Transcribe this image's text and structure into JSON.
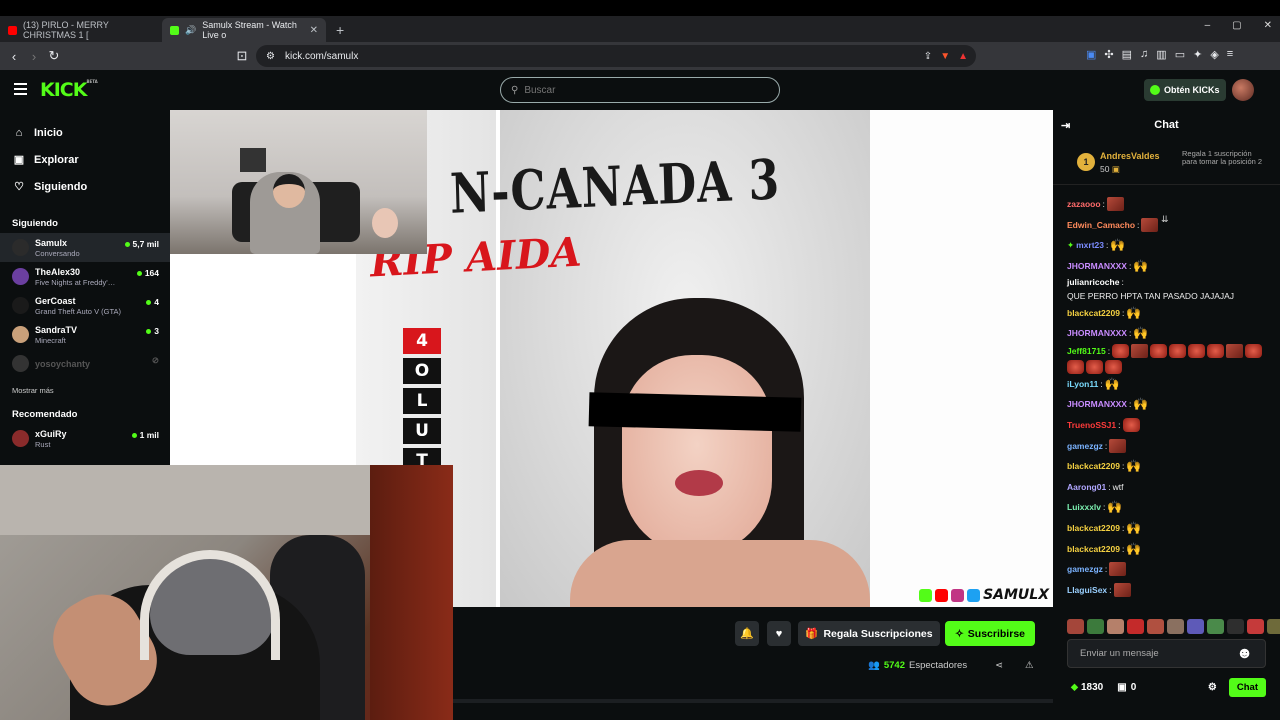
{
  "browser": {
    "tabs": [
      {
        "title": "(13) PIRLO - MERRY CHRISTMAS 1 [",
        "favicon_color": "#ff0000"
      },
      {
        "title": "Samulx Stream - Watch Live o",
        "favicon_color": "#53fc18"
      }
    ],
    "new_tab": "+",
    "url": "kick.com/samulx",
    "window_controls": [
      "–",
      "▢",
      "✕"
    ]
  },
  "header": {
    "logo": "KICK",
    "logo_tag": "BETA",
    "search_placeholder": "Buscar",
    "get_kicks": "Obtén KICKs"
  },
  "sidebar": {
    "nav": [
      {
        "label": "Inicio",
        "icon": "home-icon"
      },
      {
        "label": "Explorar",
        "icon": "compass-icon"
      },
      {
        "label": "Siguiendo",
        "icon": "heart-icon"
      }
    ],
    "following_title": "Siguiendo",
    "following": [
      {
        "name": "Samulx",
        "sub": "Conversando",
        "viewers": "5,7 mil",
        "avatar_color": "#2b2b2b"
      },
      {
        "name": "TheAlex30",
        "sub": "Five Nights at Freddy'…",
        "viewers": "164",
        "avatar_color": "#6b3fa0"
      },
      {
        "name": "GerCoast",
        "sub": "Grand Theft Auto V (GTA)",
        "viewers": "4",
        "avatar_color": "#1a1a1a"
      },
      {
        "name": "SandraTV",
        "sub": "Minecraft",
        "viewers": "3",
        "avatar_color": "#c9a07a"
      },
      {
        "name": "yosoychanty",
        "sub": "",
        "viewers": "",
        "avatar_color": "#333333"
      }
    ],
    "show_more": "Mostrar más",
    "recommended_title": "Recomendado",
    "recommended": [
      {
        "name": "xGuiRy",
        "sub": "Rust",
        "viewers": "1 mil",
        "avatar_color": "#8a2b2b"
      }
    ]
  },
  "video": {
    "title_top": "N-CANADA 3",
    "title_red": "RIP AIDA",
    "vertical_letters": [
      "4",
      "O",
      "L",
      "U",
      "T"
    ],
    "watermark": "SAMULX"
  },
  "below_video": {
    "gift_label": "Regala Suscripciones",
    "subscribe_label": "Suscribirse",
    "viewer_count": "5742",
    "viewer_label": "Espectadores"
  },
  "chat": {
    "title": "Chat",
    "pinned": {
      "rank": "1",
      "name": "AndresValdes",
      "count": "50",
      "note": "Regala 1 suscripción para tomar la posición 2"
    },
    "messages": [
      {
        "user": "zazaooo",
        "color": "#ff6b6b",
        "text": "",
        "emotes": [
          "img"
        ]
      },
      {
        "user": "Edwin_Camacho",
        "color": "#ff8a5c",
        "text": "",
        "emotes": [
          "img"
        ]
      },
      {
        "user": "mxrt23",
        "color": "#7b8cff",
        "text": "",
        "emotes": [
          "hands"
        ],
        "badge": true
      },
      {
        "user": "JHORMANXXX",
        "color": "#c98cff",
        "text": "",
        "emotes": [
          "hands"
        ]
      },
      {
        "user": "julianricoche",
        "color": "#ffffff",
        "text": "QUE PERRO HPTA TAN PASADO JAJAJAJ",
        "emotes": []
      },
      {
        "user": "blackcat2209",
        "color": "#f5d142",
        "text": "",
        "emotes": [
          "hands"
        ]
      },
      {
        "user": "JHORMANXXX",
        "color": "#c98cff",
        "text": "",
        "emotes": [
          "hands"
        ]
      },
      {
        "user": "Jeff81715",
        "color": "#53fc18",
        "text": "",
        "emotes": [
          "devil",
          "img",
          "devil",
          "devil",
          "devil",
          "devil",
          "img",
          "devil",
          "devil",
          "devil",
          "devil"
        ]
      },
      {
        "user": "iLyon11",
        "color": "#7bdcff",
        "text": "",
        "emotes": [
          "hands"
        ]
      },
      {
        "user": "JHORMANXXX",
        "color": "#c98cff",
        "text": "",
        "emotes": [
          "hands"
        ]
      },
      {
        "user": "TruenoSSJ1",
        "color": "#ff3b3b",
        "text": "",
        "emotes": [
          "devil"
        ]
      },
      {
        "user": "gamezgz",
        "color": "#7bb3ff",
        "text": "",
        "emotes": [
          "img"
        ]
      },
      {
        "user": "blackcat2209",
        "color": "#f5d142",
        "text": "",
        "emotes": [
          "hands"
        ]
      },
      {
        "user": "Aarong01",
        "color": "#b1a7ff",
        "text": "wtf",
        "emotes": []
      },
      {
        "user": "Luixxxlv",
        "color": "#7cf0b0",
        "text": "",
        "emotes": [
          "hands"
        ]
      },
      {
        "user": "blackcat2209",
        "color": "#f5d142",
        "text": "",
        "emotes": [
          "hands"
        ]
      },
      {
        "user": "blackcat2209",
        "color": "#f5d142",
        "text": "",
        "emotes": [
          "hands"
        ]
      },
      {
        "user": "gamezgz",
        "color": "#7bb3ff",
        "text": "",
        "emotes": [
          "img"
        ]
      },
      {
        "user": "LlaguiSex",
        "color": "#9ad0ff",
        "text": "",
        "emotes": [
          "img"
        ]
      }
    ],
    "emote_bar_colors": [
      "#a4463a",
      "#3c7a3c",
      "#b5806a",
      "#c42a2a",
      "#b05040",
      "#8a7060",
      "#5e5ab8",
      "#4a8a4a",
      "#2e2e2e",
      "#c53a3a",
      "#6e6a3a",
      "#3a8a3a",
      "#53fc18"
    ],
    "input_placeholder": "Enviar un mensaje",
    "kicks": "1830",
    "gifts": "0",
    "chat_button": "Chat"
  }
}
